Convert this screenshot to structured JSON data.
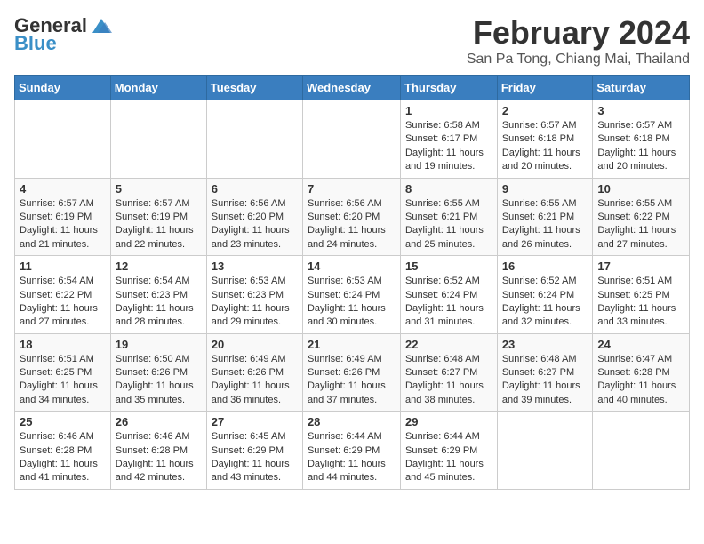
{
  "header": {
    "logo_general": "General",
    "logo_blue": "Blue",
    "month_title": "February 2024",
    "location": "San Pa Tong, Chiang Mai, Thailand"
  },
  "weekdays": [
    "Sunday",
    "Monday",
    "Tuesday",
    "Wednesday",
    "Thursday",
    "Friday",
    "Saturday"
  ],
  "weeks": [
    [
      {
        "day": "",
        "info": ""
      },
      {
        "day": "",
        "info": ""
      },
      {
        "day": "",
        "info": ""
      },
      {
        "day": "",
        "info": ""
      },
      {
        "day": "1",
        "info": "Sunrise: 6:58 AM\nSunset: 6:17 PM\nDaylight: 11 hours and 19 minutes."
      },
      {
        "day": "2",
        "info": "Sunrise: 6:57 AM\nSunset: 6:18 PM\nDaylight: 11 hours and 20 minutes."
      },
      {
        "day": "3",
        "info": "Sunrise: 6:57 AM\nSunset: 6:18 PM\nDaylight: 11 hours and 20 minutes."
      }
    ],
    [
      {
        "day": "4",
        "info": "Sunrise: 6:57 AM\nSunset: 6:19 PM\nDaylight: 11 hours and 21 minutes."
      },
      {
        "day": "5",
        "info": "Sunrise: 6:57 AM\nSunset: 6:19 PM\nDaylight: 11 hours and 22 minutes."
      },
      {
        "day": "6",
        "info": "Sunrise: 6:56 AM\nSunset: 6:20 PM\nDaylight: 11 hours and 23 minutes."
      },
      {
        "day": "7",
        "info": "Sunrise: 6:56 AM\nSunset: 6:20 PM\nDaylight: 11 hours and 24 minutes."
      },
      {
        "day": "8",
        "info": "Sunrise: 6:55 AM\nSunset: 6:21 PM\nDaylight: 11 hours and 25 minutes."
      },
      {
        "day": "9",
        "info": "Sunrise: 6:55 AM\nSunset: 6:21 PM\nDaylight: 11 hours and 26 minutes."
      },
      {
        "day": "10",
        "info": "Sunrise: 6:55 AM\nSunset: 6:22 PM\nDaylight: 11 hours and 27 minutes."
      }
    ],
    [
      {
        "day": "11",
        "info": "Sunrise: 6:54 AM\nSunset: 6:22 PM\nDaylight: 11 hours and 27 minutes."
      },
      {
        "day": "12",
        "info": "Sunrise: 6:54 AM\nSunset: 6:23 PM\nDaylight: 11 hours and 28 minutes."
      },
      {
        "day": "13",
        "info": "Sunrise: 6:53 AM\nSunset: 6:23 PM\nDaylight: 11 hours and 29 minutes."
      },
      {
        "day": "14",
        "info": "Sunrise: 6:53 AM\nSunset: 6:24 PM\nDaylight: 11 hours and 30 minutes."
      },
      {
        "day": "15",
        "info": "Sunrise: 6:52 AM\nSunset: 6:24 PM\nDaylight: 11 hours and 31 minutes."
      },
      {
        "day": "16",
        "info": "Sunrise: 6:52 AM\nSunset: 6:24 PM\nDaylight: 11 hours and 32 minutes."
      },
      {
        "day": "17",
        "info": "Sunrise: 6:51 AM\nSunset: 6:25 PM\nDaylight: 11 hours and 33 minutes."
      }
    ],
    [
      {
        "day": "18",
        "info": "Sunrise: 6:51 AM\nSunset: 6:25 PM\nDaylight: 11 hours and 34 minutes."
      },
      {
        "day": "19",
        "info": "Sunrise: 6:50 AM\nSunset: 6:26 PM\nDaylight: 11 hours and 35 minutes."
      },
      {
        "day": "20",
        "info": "Sunrise: 6:49 AM\nSunset: 6:26 PM\nDaylight: 11 hours and 36 minutes."
      },
      {
        "day": "21",
        "info": "Sunrise: 6:49 AM\nSunset: 6:26 PM\nDaylight: 11 hours and 37 minutes."
      },
      {
        "day": "22",
        "info": "Sunrise: 6:48 AM\nSunset: 6:27 PM\nDaylight: 11 hours and 38 minutes."
      },
      {
        "day": "23",
        "info": "Sunrise: 6:48 AM\nSunset: 6:27 PM\nDaylight: 11 hours and 39 minutes."
      },
      {
        "day": "24",
        "info": "Sunrise: 6:47 AM\nSunset: 6:28 PM\nDaylight: 11 hours and 40 minutes."
      }
    ],
    [
      {
        "day": "25",
        "info": "Sunrise: 6:46 AM\nSunset: 6:28 PM\nDaylight: 11 hours and 41 minutes."
      },
      {
        "day": "26",
        "info": "Sunrise: 6:46 AM\nSunset: 6:28 PM\nDaylight: 11 hours and 42 minutes."
      },
      {
        "day": "27",
        "info": "Sunrise: 6:45 AM\nSunset: 6:29 PM\nDaylight: 11 hours and 43 minutes."
      },
      {
        "day": "28",
        "info": "Sunrise: 6:44 AM\nSunset: 6:29 PM\nDaylight: 11 hours and 44 minutes."
      },
      {
        "day": "29",
        "info": "Sunrise: 6:44 AM\nSunset: 6:29 PM\nDaylight: 11 hours and 45 minutes."
      },
      {
        "day": "",
        "info": ""
      },
      {
        "day": "",
        "info": ""
      }
    ]
  ]
}
